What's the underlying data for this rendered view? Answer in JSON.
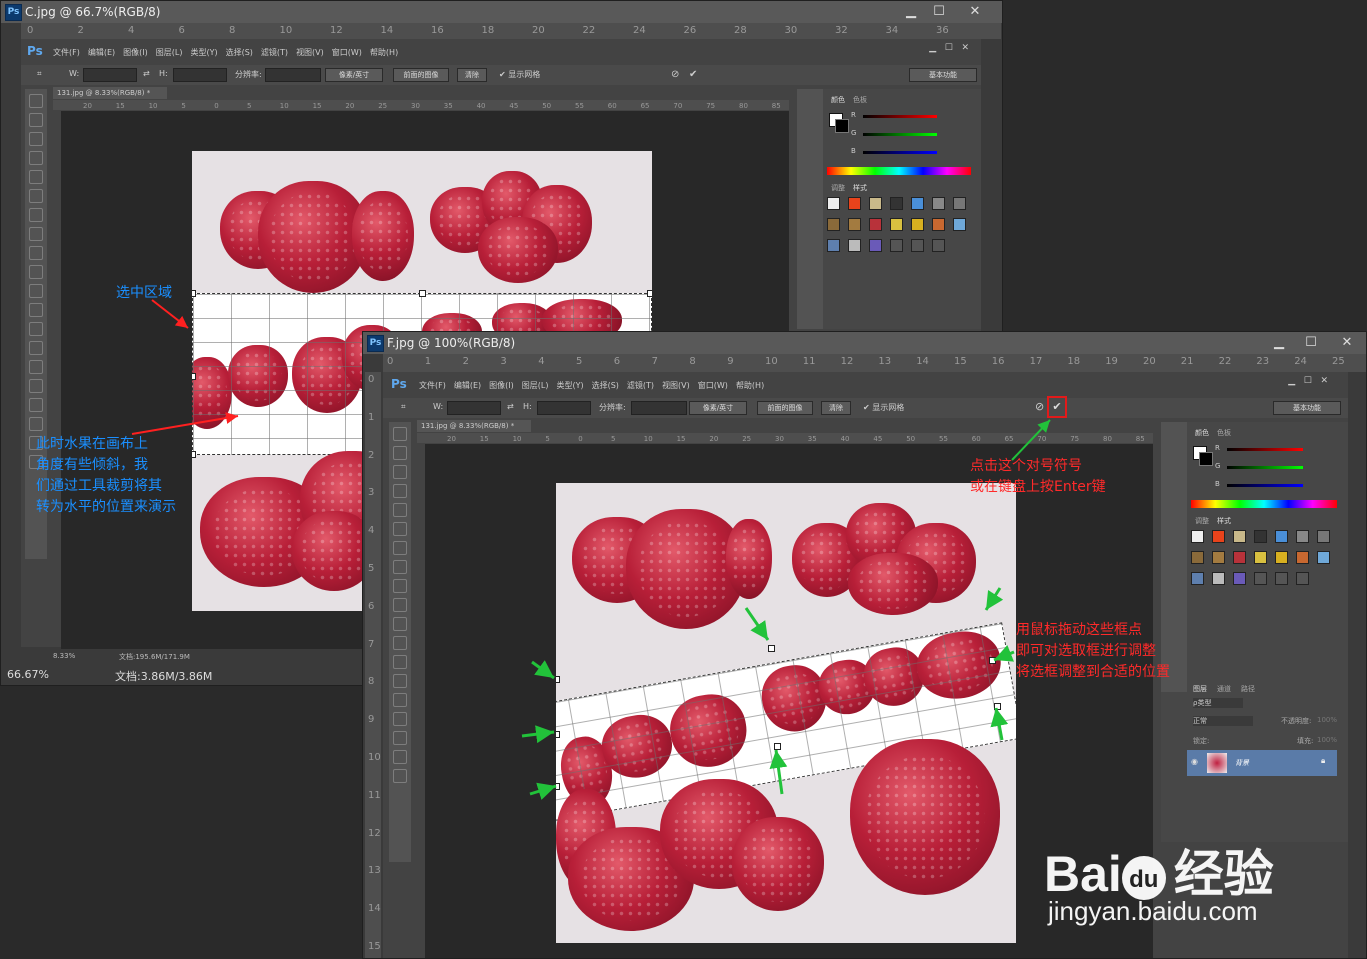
{
  "back_window": {
    "title": "C.jpg @ 66.7%(RGB/8)",
    "ruler_top": [
      "0",
      "2",
      "4",
      "6",
      "8",
      "10",
      "12",
      "14",
      "16",
      "18",
      "20",
      "22",
      "24",
      "26",
      "28",
      "30",
      "32",
      "34",
      "36"
    ],
    "menu": [
      "文件(F)",
      "编辑(E)",
      "图像(I)",
      "图层(L)",
      "类型(Y)",
      "选择(S)",
      "滤镜(T)",
      "视图(V)",
      "窗口(W)",
      "帮助(H)"
    ],
    "options": {
      "w_label": "W:",
      "h_label": "H:",
      "resolution_label": "分辨率:",
      "unit_select": "像素/英寸",
      "front_image_btn": "前面的图像",
      "clear_btn": "清除",
      "show_grid": "显示网格",
      "workspace": "基本功能"
    },
    "doc_tab": "131.jpg @ 8.33%(RGB/8) *",
    "inner_ruler": [
      "20",
      "15",
      "10",
      "5",
      "0",
      "5",
      "10",
      "15",
      "20",
      "25",
      "30",
      "35",
      "40",
      "45",
      "50",
      "55",
      "60",
      "65",
      "70",
      "75",
      "80",
      "85"
    ],
    "inner_status": {
      "zoom": "8.33%",
      "doc": "文档:195.6M/171.9M"
    },
    "status": {
      "zoom": "66.67%",
      "doc": "文档:3.86M/3.86M"
    },
    "panel_tabs": {
      "color": "颜色",
      "swatches": "色板",
      "adjust": "调整",
      "styles": "样式"
    },
    "rgb_labels": [
      "R",
      "G",
      "B"
    ]
  },
  "front_window": {
    "title": "F.jpg @ 100%(RGB/8)",
    "ruler_top": [
      "0",
      "1",
      "2",
      "3",
      "4",
      "5",
      "6",
      "7",
      "8",
      "9",
      "10",
      "11",
      "12",
      "13",
      "14",
      "15",
      "16",
      "17",
      "18",
      "19",
      "20",
      "21",
      "22",
      "23",
      "24",
      "25"
    ],
    "ruler_left": [
      "0",
      "1",
      "2",
      "3",
      "4",
      "5",
      "6",
      "7",
      "8",
      "9",
      "10",
      "11",
      "12",
      "13",
      "14",
      "15"
    ],
    "menu": [
      "文件(F)",
      "编辑(E)",
      "图像(I)",
      "图层(L)",
      "类型(Y)",
      "选择(S)",
      "滤镜(T)",
      "视图(V)",
      "窗口(W)",
      "帮助(H)"
    ],
    "options": {
      "w_label": "W:",
      "h_label": "H:",
      "resolution_label": "分辨率:",
      "unit_select": "像素/英寸",
      "front_image_btn": "前面的图像",
      "clear_btn": "清除",
      "show_grid": "显示网格",
      "workspace": "基本功能"
    },
    "doc_tab": "131.jpg @ 8.33%(RGB/8) *",
    "inner_ruler": [
      "20",
      "15",
      "10",
      "5",
      "0",
      "5",
      "10",
      "15",
      "20",
      "25",
      "30",
      "35",
      "40",
      "45",
      "50",
      "55",
      "60",
      "65",
      "70",
      "75",
      "80",
      "85"
    ],
    "panel_tabs": {
      "color": "颜色",
      "swatches": "色板",
      "adjust": "调整",
      "styles": "样式",
      "layers": "图层",
      "channels": "通道",
      "paths": "路径"
    },
    "layers": {
      "kind": "ρ类型",
      "blend": "正常",
      "opacity_label": "不透明度:",
      "opacity": "100%",
      "lock_label": "锁定:",
      "fill_label": "填充:",
      "fill": "100%",
      "layer_name": "背景"
    },
    "rgb_labels": [
      "R",
      "G",
      "B"
    ]
  },
  "annotations": {
    "select_area": "选中区域",
    "tilted": "此时水果在画布上\n角度有些倾斜，我\n们通过工具裁剪将其\n转为水平的位置来演示",
    "click_check": "点击这个对号符号\n或在键盘上按Enter键",
    "drag_handles": "用鼠标拖动这些框点\n即可对选取框进行调整\n将选框调整到合适的位置"
  },
  "watermark": {
    "brand": "Bai",
    "brand2": "du",
    "cn": "经验",
    "url": "jingyan.baidu.com"
  }
}
